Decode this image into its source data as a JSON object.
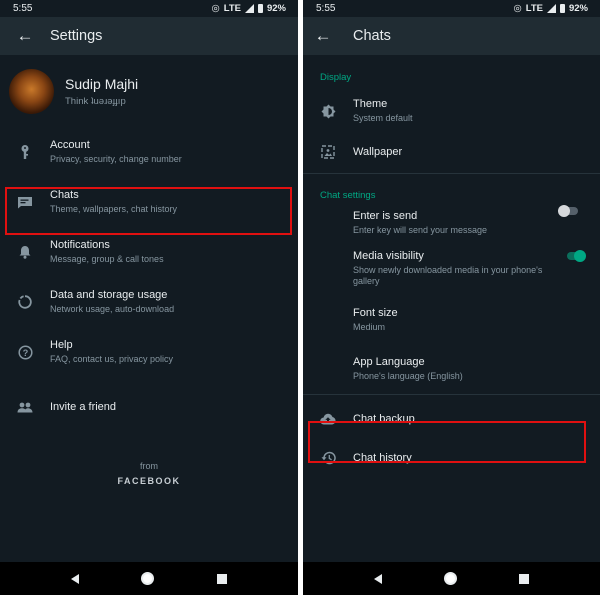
{
  "status_bar": {
    "time": "5:55",
    "network": "LTE",
    "battery": "92%"
  },
  "left_screen": {
    "appbar": {
      "title": "Settings"
    },
    "profile": {
      "name": "Sudip Majhi",
      "about": "Think ʇuǝɹǝɟɟıp"
    },
    "items": [
      {
        "icon": "key-icon",
        "title": "Account",
        "subtitle": "Privacy, security, change number"
      },
      {
        "icon": "chat-icon",
        "title": "Chats",
        "subtitle": "Theme, wallpapers, chat history",
        "highlighted": true
      },
      {
        "icon": "bell-icon",
        "title": "Notifications",
        "subtitle": "Message, group & call tones"
      },
      {
        "icon": "data-usage-icon",
        "title": "Data and storage usage",
        "subtitle": "Network usage, auto-download"
      },
      {
        "icon": "help-icon",
        "title": "Help",
        "subtitle": "FAQ, contact us, privacy policy"
      },
      {
        "icon": "people-icon",
        "title": "Invite a friend"
      }
    ],
    "footer": {
      "from": "from",
      "brand": "FACEBOOK"
    }
  },
  "right_screen": {
    "appbar": {
      "title": "Chats"
    },
    "sections": {
      "display": "Display",
      "chat_settings": "Chat settings"
    },
    "display_items": [
      {
        "icon": "theme-icon",
        "title": "Theme",
        "subtitle": "System default"
      },
      {
        "icon": "wallpaper-icon",
        "title": "Wallpaper"
      }
    ],
    "chat_settings_items": [
      {
        "title": "Enter is send",
        "subtitle": "Enter key will send your message",
        "toggle": false
      },
      {
        "title": "Media visibility",
        "subtitle": "Show newly downloaded media in your phone's gallery",
        "toggle": true
      },
      {
        "title": "Font size",
        "subtitle": "Medium"
      },
      {
        "title": "App Language",
        "subtitle": "Phone's language (English)"
      }
    ],
    "bottom_items": [
      {
        "icon": "cloud-upload-icon",
        "title": "Chat backup",
        "highlighted": true
      },
      {
        "icon": "history-icon",
        "title": "Chat history"
      }
    ]
  },
  "colors": {
    "accent": "#00a884",
    "background": "#121b22",
    "appbar": "#202c33",
    "highlight": "#e01010"
  }
}
